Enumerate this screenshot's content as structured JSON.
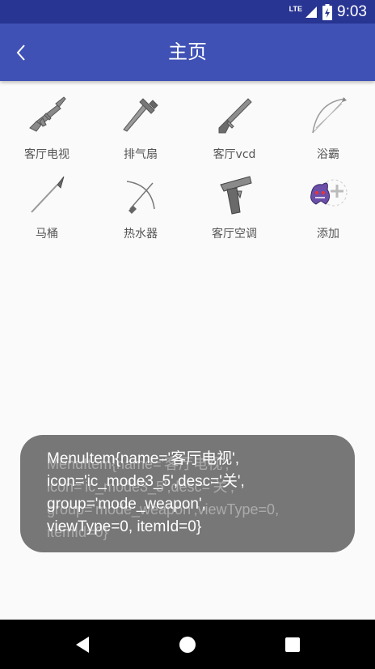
{
  "status_bar": {
    "network": "LTE",
    "time": "9:03",
    "icons": [
      "signal-icon",
      "battery-charging-icon"
    ]
  },
  "app_bar": {
    "title": "主页",
    "back_icon": "chevron-left-icon"
  },
  "grid": {
    "items": [
      {
        "label": "客厅电视",
        "icon": "machine-gun-icon"
      },
      {
        "label": "排气扇",
        "icon": "hammer-icon"
      },
      {
        "label": "客厅vcd",
        "icon": "shotgun-icon"
      },
      {
        "label": "浴霸",
        "icon": "bow-icon"
      },
      {
        "label": "马桶",
        "icon": "spear-icon"
      },
      {
        "label": "热水器",
        "icon": "crossbow-icon"
      },
      {
        "label": "客厅空调",
        "icon": "pistol-icon"
      },
      {
        "label": "添加",
        "icon": "add-ghost-icon"
      }
    ]
  },
  "toast": {
    "text": "MenuItem{name='客厅电视',\nicon='ic_mode3_5',desc='关',\ngroup='mode_weapon',\nviewType=0, itemId=0}",
    "ghost_text": "MenuItem{name='客厅电视',\nicon='ic_mode3_5',desc='关',\ngroup='mode_weapon',viewType=0,\nitemId=0}"
  },
  "nav_bar": {
    "back": "triangle-back-icon",
    "home": "circle-home-icon",
    "recents": "square-recents-icon"
  },
  "colors": {
    "status_bar": "#283593",
    "app_bar": "#3f51b5",
    "background": "#fafafa",
    "toast": "#646464"
  }
}
